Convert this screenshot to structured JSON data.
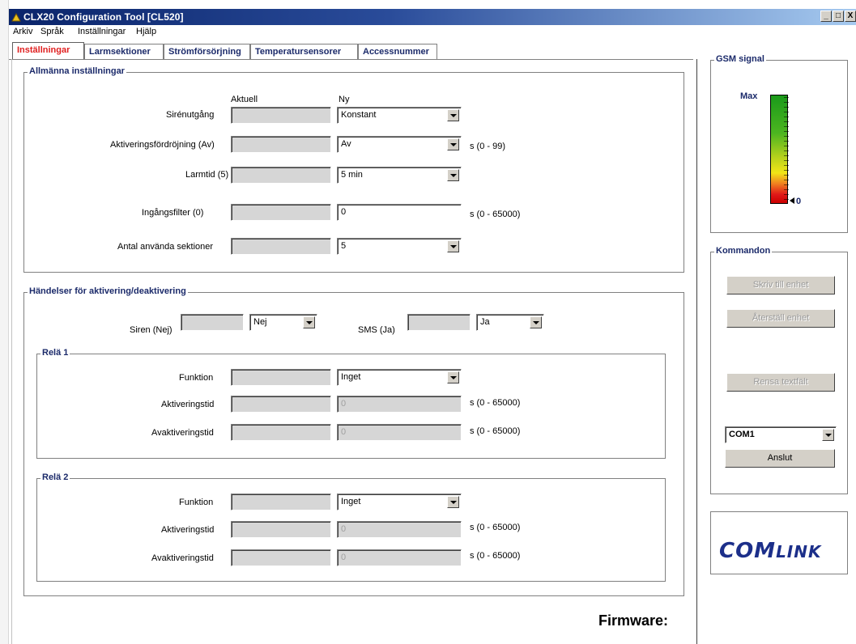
{
  "window": {
    "title": "CLX20 Configuration Tool  [CL520]",
    "buttons": [
      "_",
      "□",
      "X"
    ]
  },
  "menu": [
    "Arkiv",
    "Språk",
    "Inställningar",
    "Hjälp"
  ],
  "tabs": [
    "Inställningar",
    "Larmsektioner",
    "Strömförsörjning",
    "Temperatursensorer",
    "Accessnummer"
  ],
  "general": {
    "title": "Allmänna inställningar",
    "col_current": "Aktuell",
    "col_new": "Ny",
    "rows": [
      {
        "label": "Sirénutgång",
        "value": "Konstant",
        "unit": ""
      },
      {
        "label": "Aktiveringsfördröjning (Av)",
        "value": "Av",
        "unit": "s  (0 - 99)"
      },
      {
        "label": "Larmtid (5)",
        "value": "5 min",
        "unit": ""
      },
      {
        "label": "Ingångsfilter (0)",
        "value": "0",
        "unit": "s  (0 - 65000)"
      },
      {
        "label": "Antal använda sektioner",
        "value": "5",
        "unit": ""
      }
    ]
  },
  "events": {
    "title": "Händelser för aktivering/deaktivering",
    "siren_label": "Siren (Nej)",
    "siren_value": "Nej",
    "sms_label": "SMS (Ja)",
    "sms_value": "Ja"
  },
  "relay1": {
    "title": "Relä 1",
    "function_label": "Funktion",
    "function_value": "Inget",
    "act_label": "Aktiveringstid",
    "act_value": "0",
    "deact_label": "Avaktiveringstid",
    "deact_value": "0",
    "unit": "s  (0 - 65000)"
  },
  "relay2": {
    "title": "Relä 2",
    "function_label": "Funktion",
    "function_value": "Inget",
    "act_label": "Aktiveringstid",
    "act_value": "0",
    "deact_label": "Avaktiveringstid",
    "deact_value": "0",
    "unit": "s  (0 - 65000)"
  },
  "gsm": {
    "title": "GSM signal",
    "max_label": "Max",
    "current_level": "0"
  },
  "commands": {
    "title": "Kommandon",
    "write_button": "Skriv till enhet",
    "reset_button": "Återställ enhet",
    "clear_button": "Rensa textfält",
    "port_value": "COM1",
    "connect_button": "Anslut"
  },
  "logo": {
    "text_com": "COM",
    "text_link": "LINK"
  },
  "firmware_label": "Firmware:"
}
